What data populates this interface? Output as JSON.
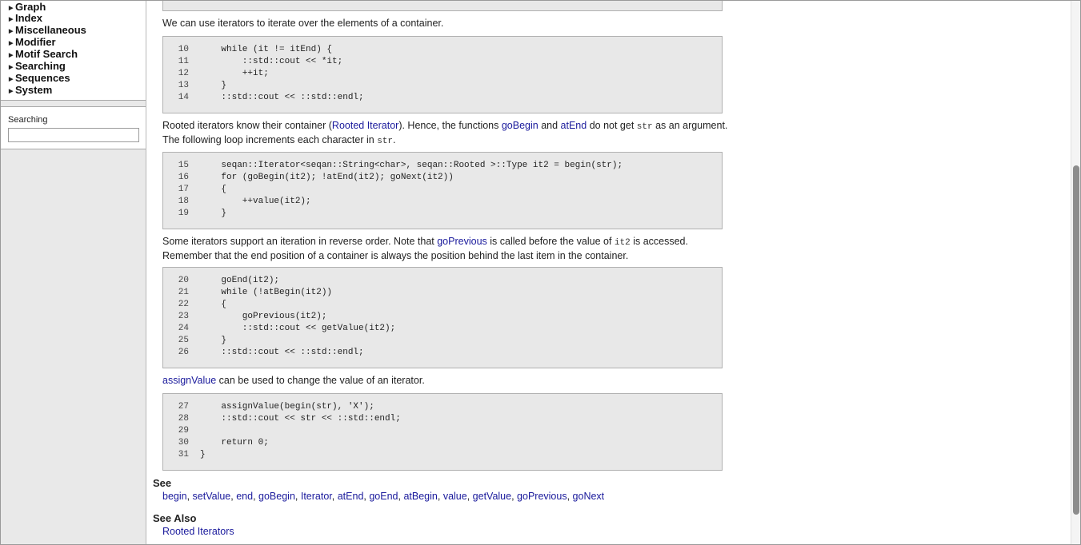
{
  "sidebar": {
    "nav_items": [
      "Graph",
      "Index",
      "Miscellaneous",
      "Modifier",
      "Motif Search",
      "Searching",
      "Sequences",
      "System"
    ],
    "search": {
      "label": "Searching",
      "value": "",
      "placeholder": ""
    }
  },
  "content": {
    "p1": "We can use iterators to iterate over the elements of a container.",
    "code1": [
      {
        "n": "10",
        "t": "    while (it != itEnd) {"
      },
      {
        "n": "11",
        "t": "        ::std::cout << *it;"
      },
      {
        "n": "12",
        "t": "        ++it;"
      },
      {
        "n": "13",
        "t": "    }"
      },
      {
        "n": "14",
        "t": "    ::std::cout << ::std::endl;"
      }
    ],
    "p2": {
      "a": "Rooted iterators know their container (",
      "link1": "Rooted Iterator",
      "b": "). Hence, the functions ",
      "link2": "goBegin",
      "c": " and ",
      "link3": "atEnd",
      "d": " do not get ",
      "code1": "str",
      "e": " as an argument. The following loop increments each character in ",
      "code2": "str",
      "f": "."
    },
    "code2": [
      {
        "n": "15",
        "t": "    seqan::Iterator<seqan::String<char>, seqan::Rooted >::Type it2 = begin(str);"
      },
      {
        "n": "16",
        "t": "    for (goBegin(it2); !atEnd(it2); goNext(it2))"
      },
      {
        "n": "17",
        "t": "    {"
      },
      {
        "n": "18",
        "t": "        ++value(it2);"
      },
      {
        "n": "19",
        "t": "    }"
      }
    ],
    "p3": {
      "a": "Some iterators support an iteration in reverse order. Note that ",
      "link1": "goPrevious",
      "b": " is called before the value of ",
      "code1": "it2",
      "c": " is accessed. Remember that the end position of a container is always the position behind the last item in the container."
    },
    "code3": [
      {
        "n": "20",
        "t": "    goEnd(it2);"
      },
      {
        "n": "21",
        "t": "    while (!atBegin(it2))"
      },
      {
        "n": "22",
        "t": "    {"
      },
      {
        "n": "23",
        "t": "        goPrevious(it2);"
      },
      {
        "n": "24",
        "t": "        ::std::cout << getValue(it2);"
      },
      {
        "n": "25",
        "t": "    }"
      },
      {
        "n": "26",
        "t": "    ::std::cout << ::std::endl;"
      }
    ],
    "p4": {
      "link1": "assignValue",
      "a": " can be used to change the value of an iterator."
    },
    "code4": [
      {
        "n": "27",
        "t": "    assignValue(begin(str), 'X');"
      },
      {
        "n": "28",
        "t": "    ::std::cout << str << ::std::endl;"
      },
      {
        "n": "29",
        "t": ""
      },
      {
        "n": "30",
        "t": "    return 0;"
      },
      {
        "n": "31",
        "t": "}"
      }
    ],
    "see": {
      "heading": "See",
      "links": [
        "begin",
        "setValue",
        "end",
        "goBegin",
        "Iterator",
        "atEnd",
        "goEnd",
        "atBegin",
        "value",
        "getValue",
        "goPrevious",
        "goNext"
      ]
    },
    "see_also": {
      "heading": "See Also",
      "links": [
        "Rooted Iterators"
      ]
    }
  }
}
